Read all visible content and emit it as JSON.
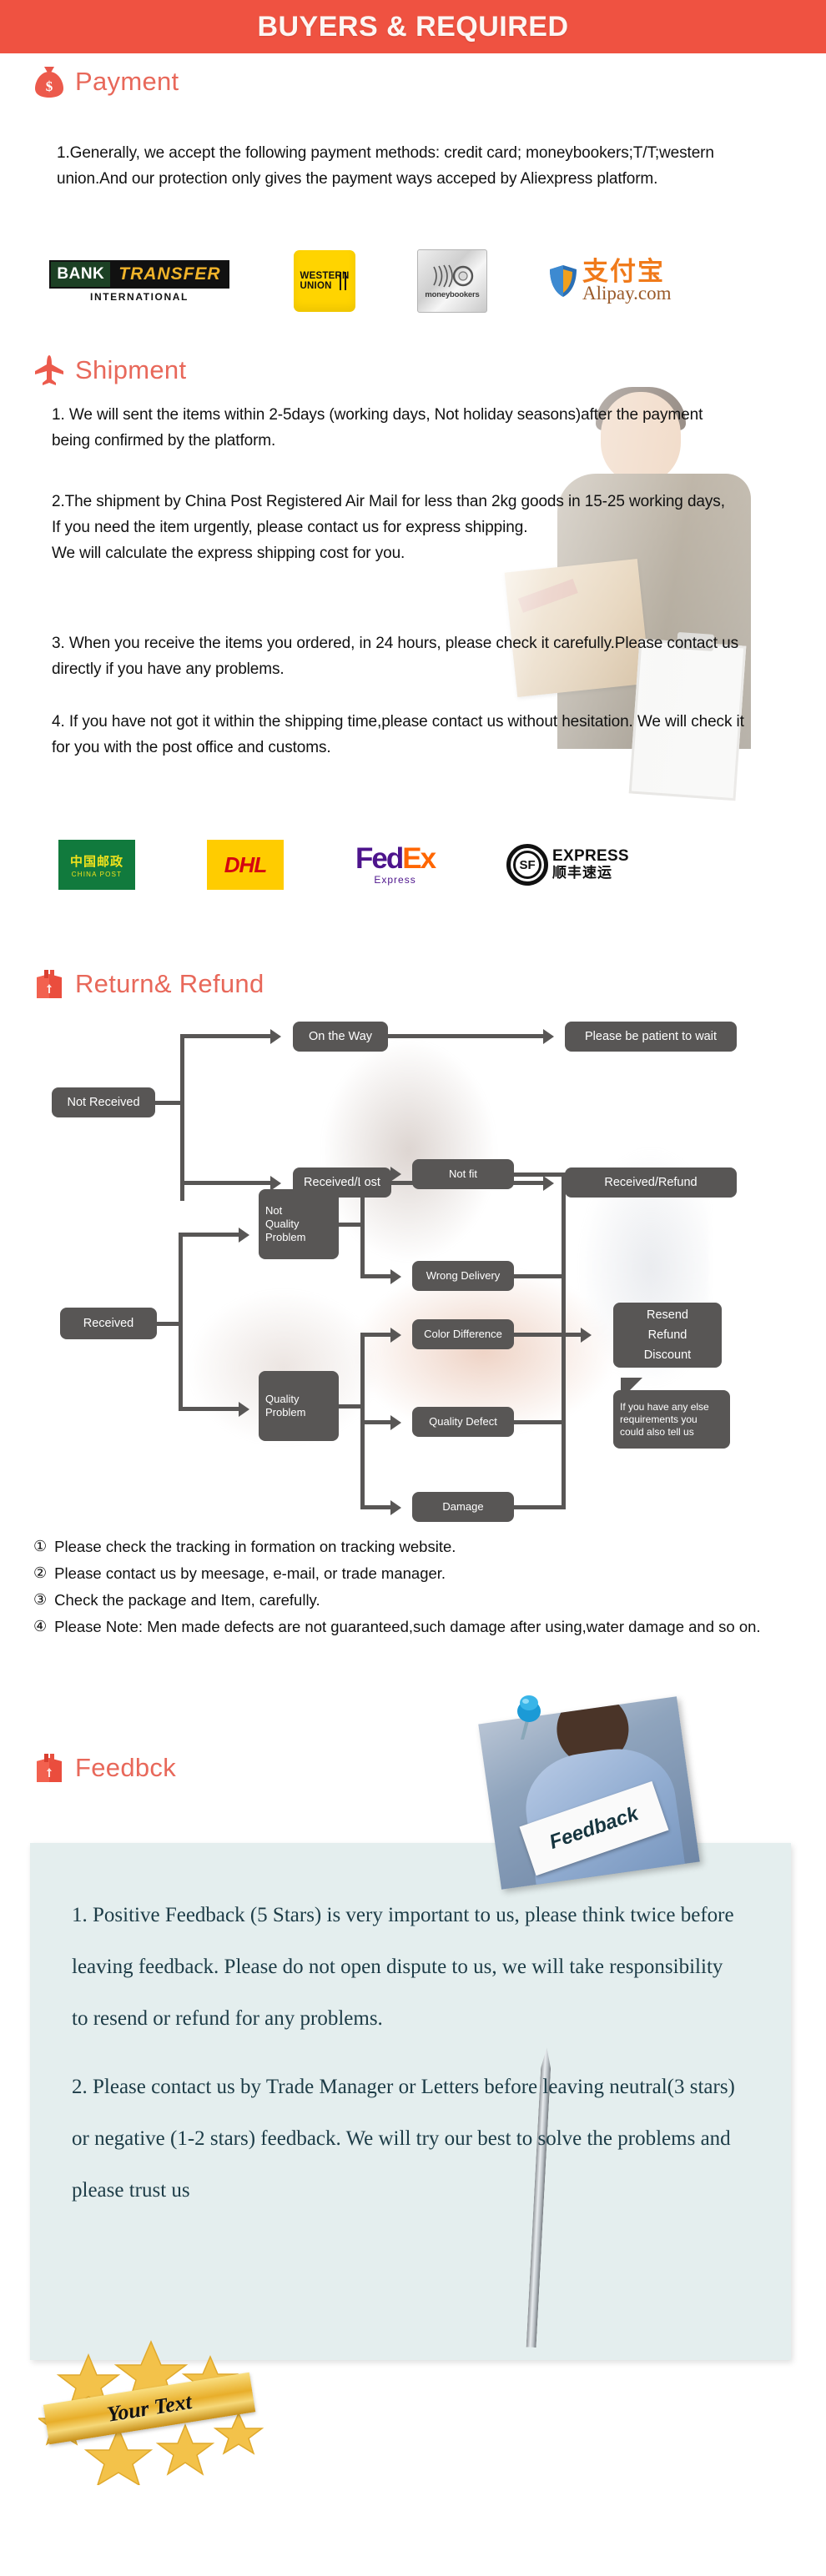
{
  "banner": {
    "title": "BUYERS & REQUIRED"
  },
  "payment": {
    "heading": "Payment",
    "icon": "money-bag-icon",
    "accent": "#e8685a",
    "body": "1.Generally, we accept the following payment methods: credit card; moneybookers;T/T;western union.And our protection only gives the payment ways acceped by Aliexpress platform.",
    "logos": [
      {
        "name": "bank-transfer-logo",
        "word1": "BANK",
        "word2": "TRANSFER",
        "sub": "INTERNATIONAL"
      },
      {
        "name": "western-union-logo",
        "line1": "WESTERN",
        "line2": "UNION"
      },
      {
        "name": "moneybookers-logo",
        "label": "moneybookers"
      },
      {
        "name": "alipay-logo",
        "cn": "支付宝",
        "en": "Alipay.com"
      }
    ]
  },
  "shipment": {
    "heading": "Shipment",
    "icon": "airplane-icon",
    "paragraphs": [
      "1. We will sent the items within 2-5days (working days, Not holiday seasons)after the payment being confirmed by the platform.",
      "2.The shipment by China Post Registered Air Mail for less than  2kg goods in 15-25 working days, If  you need the item urgently, please contact us for express shipping.\nWe will calculate the express shipping cost for you.",
      "3. When you receive the items you ordered, in 24 hours, please check  it carefully.Please contact us directly if you have any problems.",
      "4. If you have not got it within the shipping time,please contact us without hesitation. We will check it for you with the post office and customs."
    ],
    "carriers": [
      {
        "name": "china-post-logo",
        "cn": "中国邮政",
        "en": "CHINA POST"
      },
      {
        "name": "dhl-logo",
        "label": "DHL"
      },
      {
        "name": "fedex-logo",
        "part1": "Fed",
        "part2": "Ex",
        "sub": "Express"
      },
      {
        "name": "sf-express-logo",
        "mark": "SF",
        "en": "EXPRESS",
        "cn": "顺丰速运"
      }
    ]
  },
  "return_refund": {
    "heading": "Return& Refund",
    "icon": "open-box-icon",
    "flowchart": {
      "type": "flowchart",
      "nodes": [
        {
          "id": "not-received",
          "label": "Not Received"
        },
        {
          "id": "on-the-way",
          "label": "On the Way"
        },
        {
          "id": "please-be-patient",
          "label": "Please be patient to wait"
        },
        {
          "id": "received-lost",
          "label": "Received/Lost"
        },
        {
          "id": "received-refund",
          "label": "Received/Refund"
        },
        {
          "id": "received",
          "label": "Received"
        },
        {
          "id": "not-quality-problem",
          "label": "Not\nQuality\nProblem"
        },
        {
          "id": "quality-problem",
          "label": "Quality\nProblem"
        },
        {
          "id": "not-fit",
          "label": "Not fit"
        },
        {
          "id": "wrong-delivery",
          "label": "Wrong Delivery"
        },
        {
          "id": "color-difference",
          "label": "Color Difference"
        },
        {
          "id": "quality-defect",
          "label": "Quality Defect"
        },
        {
          "id": "damage",
          "label": "Damage"
        },
        {
          "id": "resend-refund-discount",
          "label": "Resend\nRefund\nDiscount"
        },
        {
          "id": "else-requirements",
          "label": "If you have any else requirements you could also tell us"
        }
      ]
    },
    "notes": [
      {
        "num": "①",
        "text": "Please check the tracking in formation on tracking website."
      },
      {
        "num": "②",
        "text": "Please contact us by meesage, e-mail, or trade manager."
      },
      {
        "num": "③",
        "text": "Check the package and Item, carefully."
      },
      {
        "num": "④",
        "text": "Please Note: Men made defects  are not guaranteed,such damage after using,water damage and so on."
      }
    ]
  },
  "feedback": {
    "heading": "Feedbck",
    "icon": "open-box-icon",
    "photo_sign_label": "Feedback",
    "paragraphs": [
      "1. Positive Feedback (5 Stars) is very important to us, please think twice before leaving feedback. Please do not open dispute to us,   we will take responsibility to resend or refund for any problems.",
      "2. Please contact us by Trade Manager or Letters before leaving neutral(3 stars) or negative (1-2 stars) feedback. We will try our best to solve the problems and please trust us"
    ],
    "badge_label": "Your Text",
    "panel_color": "#e4eeee",
    "text_color": "#1d3c47"
  }
}
